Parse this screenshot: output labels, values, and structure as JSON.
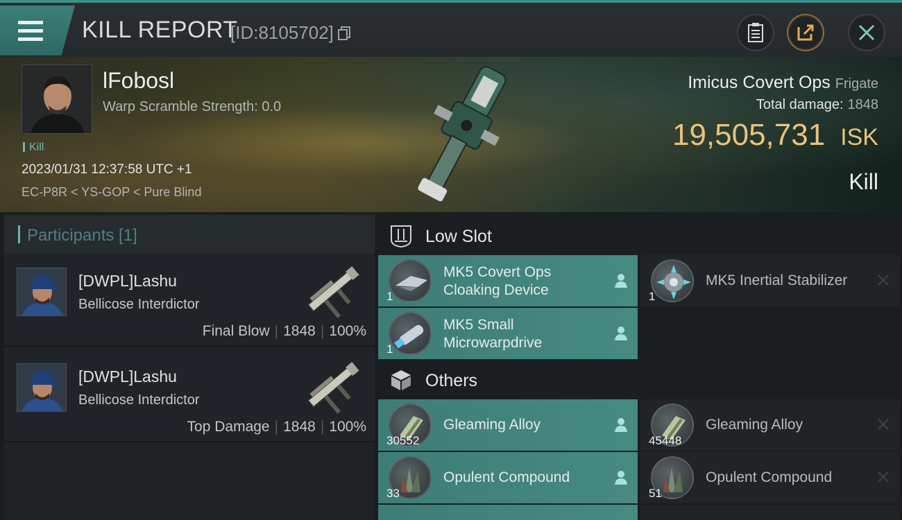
{
  "header": {
    "title": "KILL REPORT",
    "report_id": "[ID:8105702]"
  },
  "victim": {
    "name": "lFobosl",
    "warp_scramble": "Warp Scramble Strength: 0.0",
    "tag": "Kill",
    "datetime": "2023/01/31 12:37:58 UTC +1",
    "location": "EC-P8R < YS-GOP < Pure Blind",
    "ship": "Imicus Covert Ops",
    "ship_class": "Frigate",
    "total_damage_label": "Total damage:",
    "total_damage": "1848",
    "isk_value": "19,505,731",
    "isk_unit": "ISK",
    "result": "Kill"
  },
  "participants": {
    "title": "Participants [1]",
    "rows": [
      {
        "name": "[DWPL]Lashu",
        "ship": "Bellicose Interdictor",
        "role": "Final Blow",
        "damage": "1848",
        "percent": "100%"
      },
      {
        "name": "[DWPL]Lashu",
        "ship": "Bellicose Interdictor",
        "role": "Top Damage",
        "damage": "1848",
        "percent": "100%"
      }
    ]
  },
  "low_slot": {
    "title": "Low Slot",
    "items": [
      {
        "name": "MK5 Covert Ops Cloaking Device",
        "qty": "1",
        "state": "dropped"
      },
      {
        "name": "MK5 Inertial Stabilizer",
        "qty": "1",
        "state": "destroyed"
      },
      {
        "name": "MK5 Small Microwarpdrive",
        "qty": "1",
        "state": "dropped"
      }
    ]
  },
  "others": {
    "title": "Others",
    "items": [
      {
        "name": "Gleaming Alloy",
        "qty": "30552",
        "state": "dropped"
      },
      {
        "name": "Gleaming Alloy",
        "qty": "45448",
        "state": "destroyed"
      },
      {
        "name": "Opulent Compound",
        "qty": "33",
        "state": "dropped"
      },
      {
        "name": "Opulent Compound",
        "qty": "51",
        "state": "destroyed"
      }
    ]
  },
  "colors": {
    "accent_teal": "#3e7d77",
    "isk_gold": "#e8c37c"
  },
  "icons": [
    "menu-icon",
    "copy-icon",
    "clipboard-icon",
    "share-icon",
    "close-icon",
    "low-slot-icon",
    "cube-icon",
    "person-icon",
    "x-icon"
  ]
}
